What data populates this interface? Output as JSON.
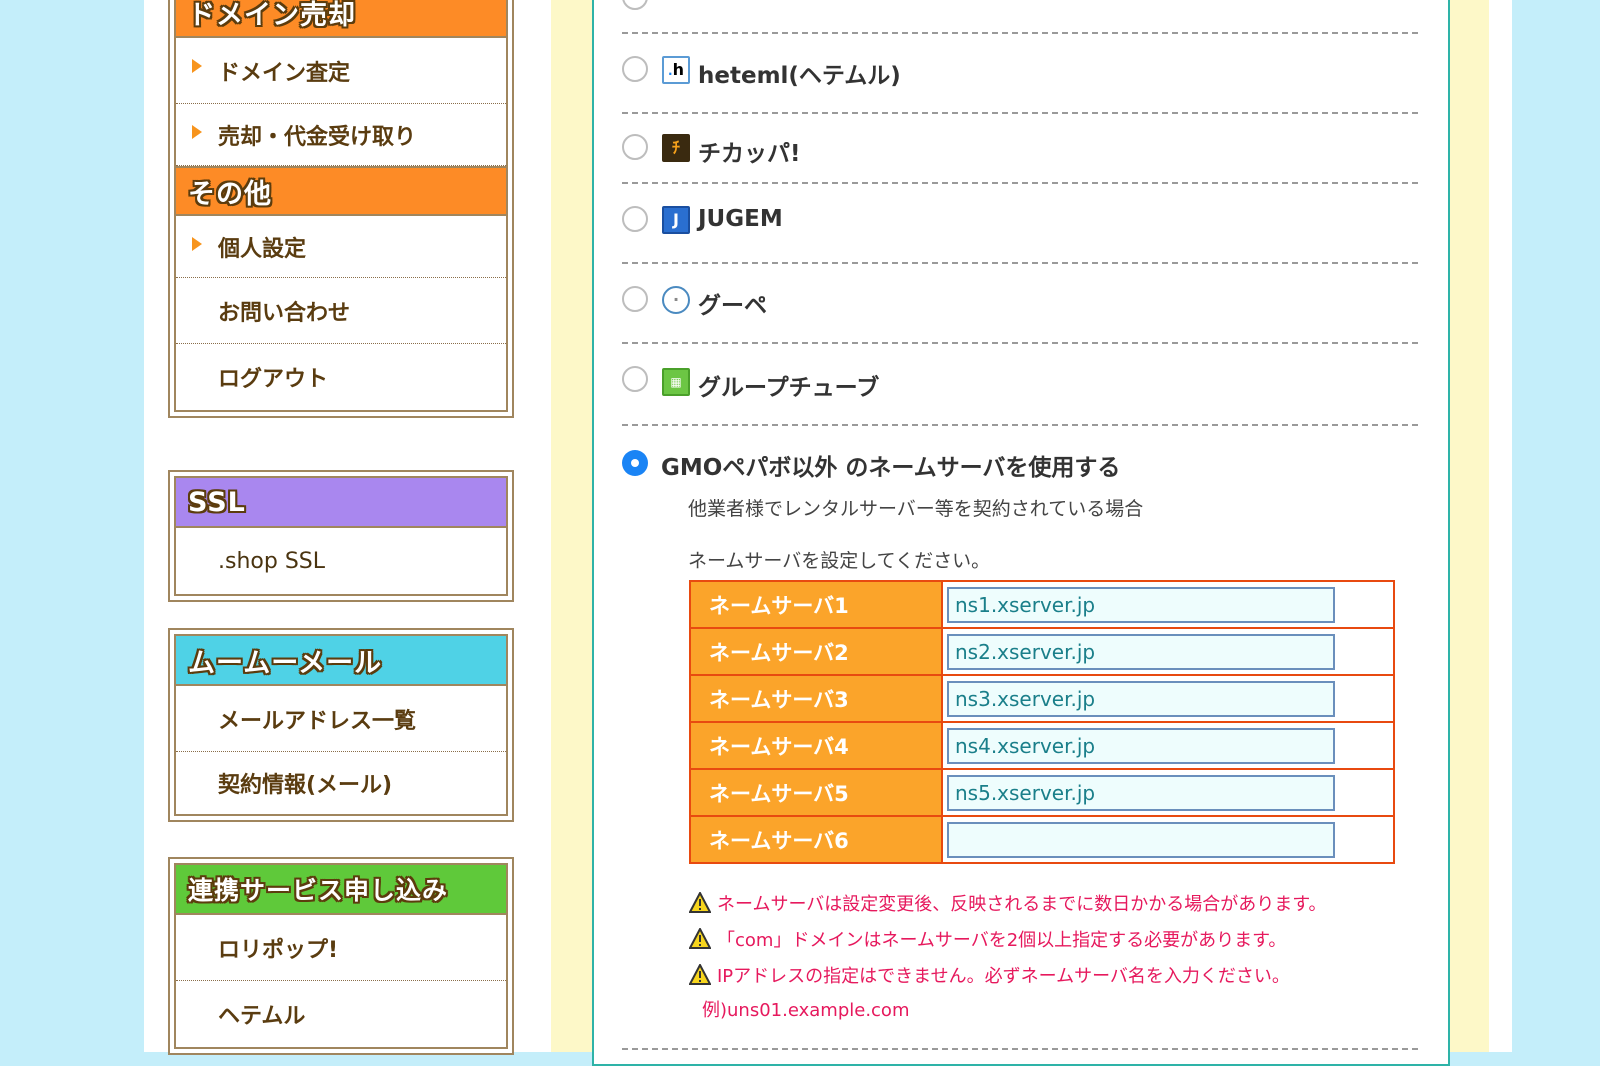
{
  "sidebar": {
    "domain_sale": {
      "title": "ドメイン売却",
      "items": [
        {
          "label": "ドメイン査定"
        },
        {
          "label": "売却・代金受け取り"
        }
      ]
    },
    "other": {
      "title": "その他",
      "items": [
        {
          "label": "個人設定"
        },
        {
          "label": "お問い合わせ"
        },
        {
          "label": "ログアウト"
        }
      ]
    },
    "ssl": {
      "title": "SSL",
      "items": [
        {
          "label": ".shop SSL"
        }
      ]
    },
    "mumumail": {
      "title": "ムームーメール",
      "items": [
        {
          "label": "メールアドレス一覧"
        },
        {
          "label": "契約情報(メール)"
        }
      ]
    },
    "services": {
      "title": "連携サービス申し込み",
      "items": [
        {
          "label": "ロリポップ!"
        },
        {
          "label": "ヘテムル"
        }
      ]
    }
  },
  "main": {
    "options": [
      {
        "label": "heteml(ヘテムル)",
        "icon": "heteml-logo-icon",
        "checked": false
      },
      {
        "label": "チカッパ!",
        "icon": "chicappa-logo-icon",
        "checked": false
      },
      {
        "label": "JUGEM",
        "icon": "jugem-logo-icon",
        "checked": false
      },
      {
        "label": "グーペ",
        "icon": "goope-logo-icon",
        "checked": false
      },
      {
        "label": "グループチューブ",
        "icon": "grouptube-logo-icon",
        "checked": false
      }
    ],
    "other_ns": {
      "label": "GMOペパボ以外 のネームサーバを使用する",
      "checked": true,
      "note": "他業者様でレンタルサーバー等を契約されている場合",
      "instruction": "ネームサーバを設定してください。"
    },
    "nameservers": [
      {
        "label": "ネームサーバ1",
        "value": "ns1.xserver.jp"
      },
      {
        "label": "ネームサーバ2",
        "value": "ns2.xserver.jp"
      },
      {
        "label": "ネームサーバ3",
        "value": "ns3.xserver.jp"
      },
      {
        "label": "ネームサーバ4",
        "value": "ns4.xserver.jp"
      },
      {
        "label": "ネームサーバ5",
        "value": "ns5.xserver.jp"
      },
      {
        "label": "ネームサーバ6",
        "value": ""
      }
    ],
    "warnings": [
      "ネームサーバは設定変更後、反映されるまでに数日かかる場合があります。",
      "「com」ドメインはネームサーバを2個以上指定する必要があります。",
      "IPアドレスの指定はできません。必ずネームサーバ名を入力ください。"
    ],
    "example": "例)uns01.example.com"
  },
  "colors": {
    "background": "#c4eefa",
    "main_bg": "#fdf8c8",
    "panel_border": "#2eb3a8",
    "table_label": "#fba42a",
    "table_border": "#e84a10",
    "warning_text": "#e6195d",
    "radio_checked": "#1a84f5"
  }
}
